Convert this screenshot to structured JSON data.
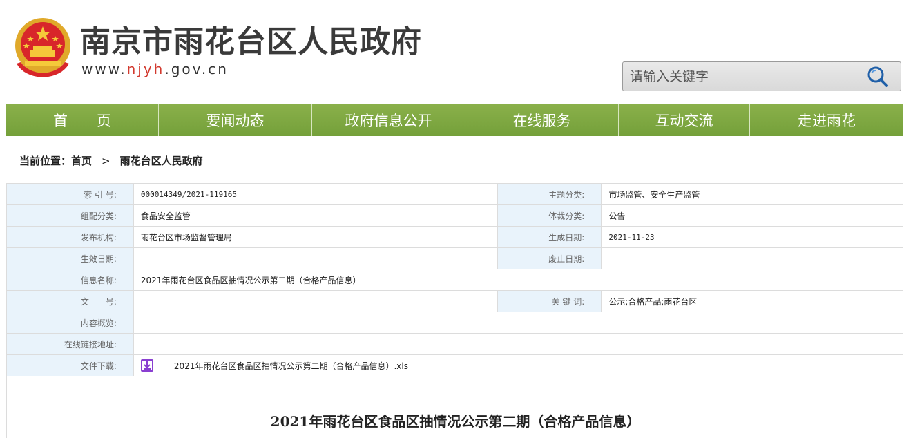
{
  "header": {
    "site_title": "南京市雨花台区人民政府",
    "url_prefix": "www.",
    "url_highlight": "njyh",
    "url_suffix": ".gov.cn",
    "search_placeholder": "请输入关键字"
  },
  "nav": {
    "items": [
      "首　　页",
      "要闻动态",
      "政府信息公开",
      "在线服务",
      "互动交流",
      "走进雨花"
    ]
  },
  "breadcrumb": {
    "prefix": "当前位置：",
    "home": "首页",
    "separator": ">",
    "current": "雨花台区人民政府"
  },
  "info": {
    "index_label": "索 引 号:",
    "index_value": "000014349/2021-119165",
    "topic_label": "主题分类:",
    "topic_value": "市场监管、安全生产监管",
    "org_cat_label": "组配分类:",
    "org_cat_value": "食品安全监管",
    "genre_label": "体裁分类:",
    "genre_value": "公告",
    "publisher_label": "发布机构:",
    "publisher_value": "雨花台区市场监督管理局",
    "created_label": "生成日期:",
    "created_value": "2021-11-23",
    "effective_label": "生效日期:",
    "effective_value": "",
    "expire_label": "废止日期:",
    "expire_value": "",
    "name_label": "信息名称:",
    "name_value": "2021年雨花台区食品区抽情况公示第二期（合格产品信息）",
    "docno_label": "文　　号:",
    "docno_value": "",
    "keywords_label": "关 键 词:",
    "keywords_value": "公示;合格产品;雨花台区",
    "summary_label": "内容概览:",
    "summary_value": "",
    "link_label": "在线链接地址:",
    "link_value": "",
    "download_label": "文件下载:",
    "download_file": "2021年雨花台区食品区抽情况公示第二期（合格产品信息）.xls"
  },
  "article": {
    "title": "2021年雨花台区食品区抽情况公示第二期（合格产品信息）"
  },
  "colors": {
    "nav_green": "#7ba63f",
    "label_bg": "#e9f3fb",
    "url_red": "#d23a2f",
    "download_icon": "#8a3fd1"
  },
  "icons": {
    "emblem": "national-emblem-icon",
    "search": "search-icon",
    "download": "download-icon"
  }
}
